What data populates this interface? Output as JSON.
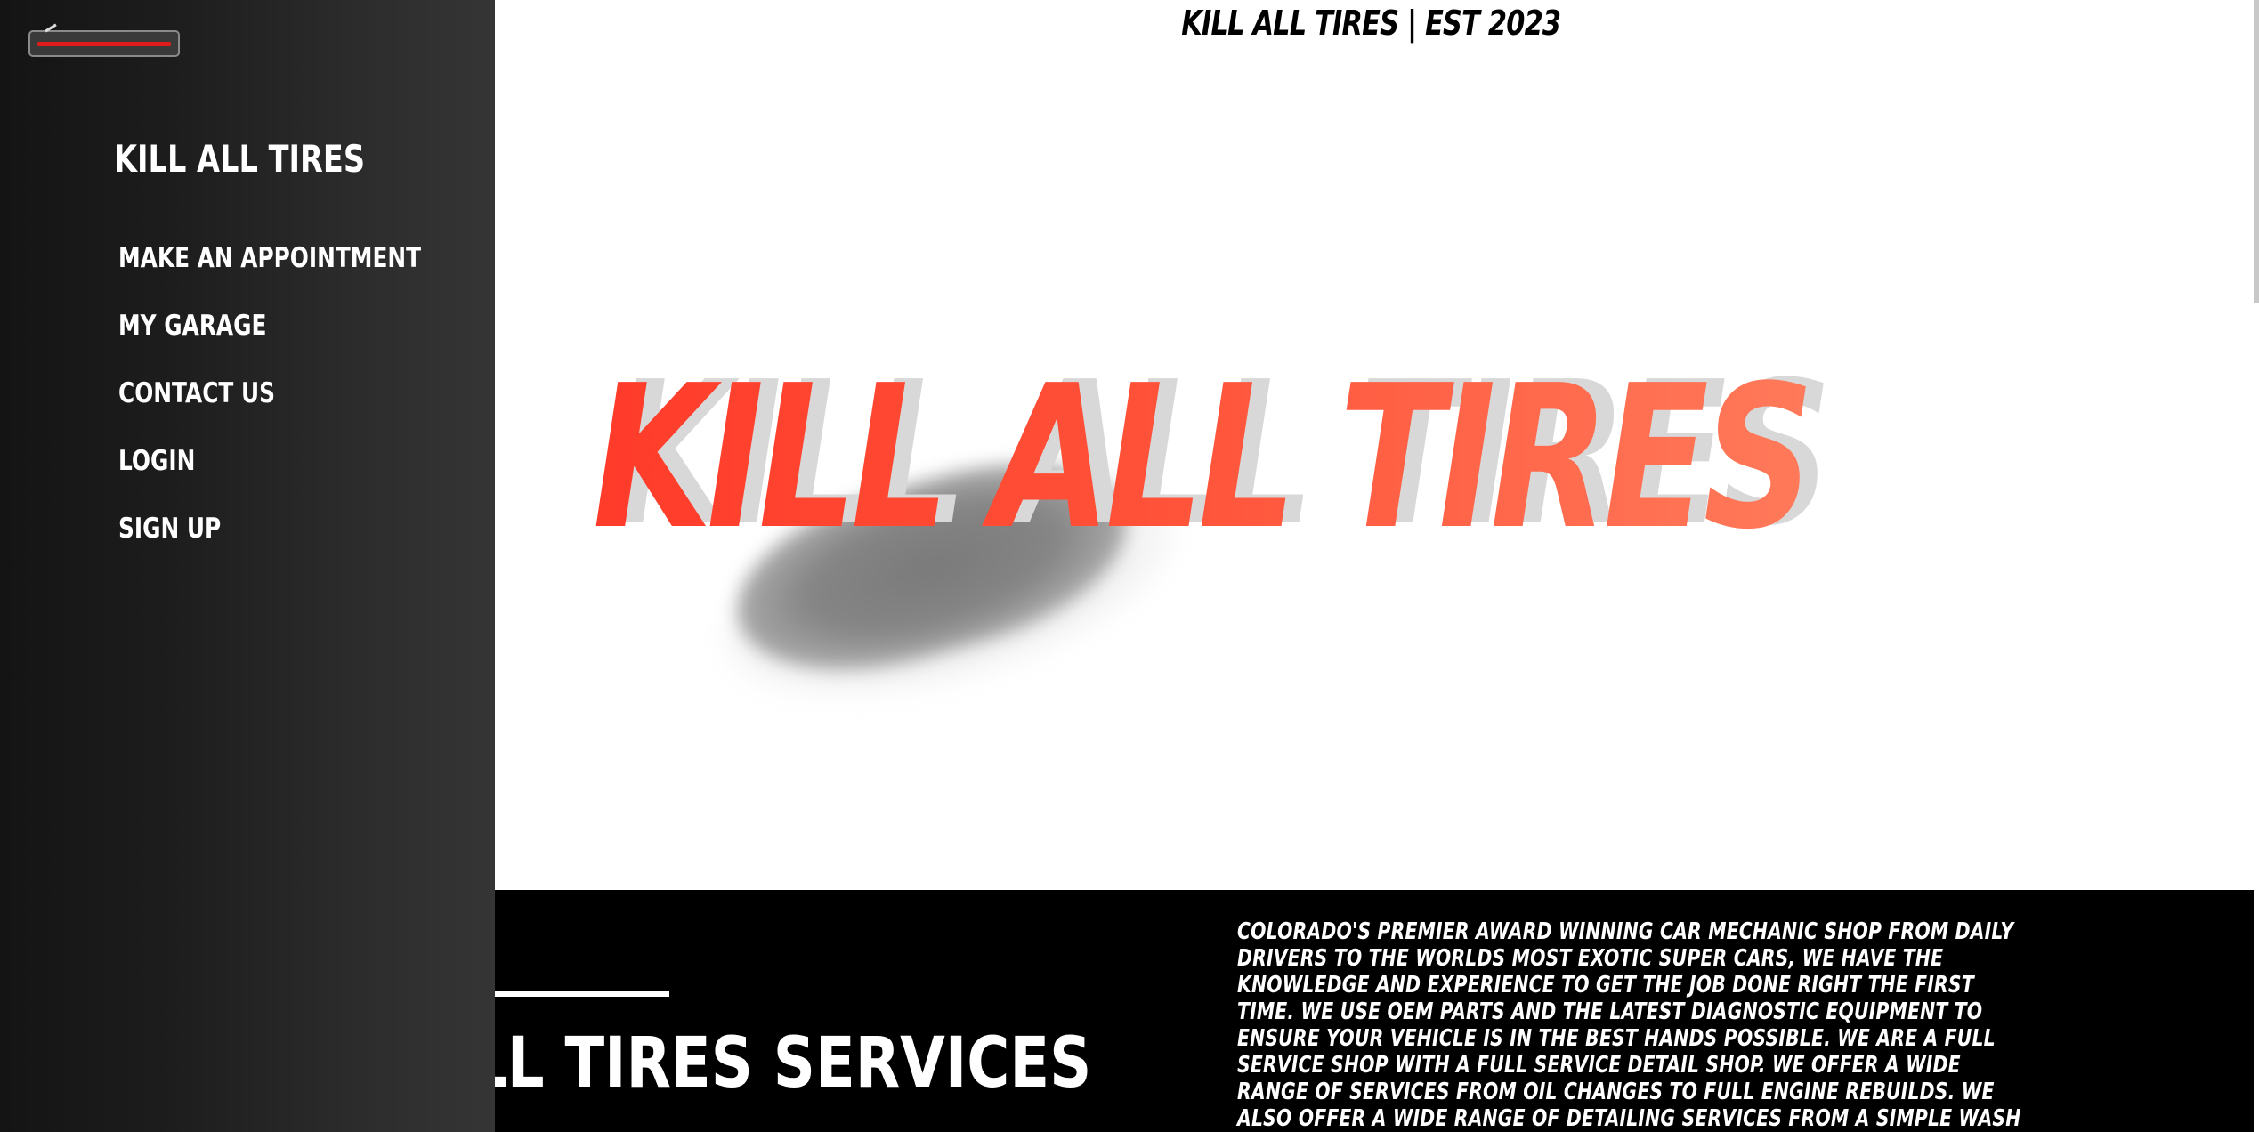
{
  "header": {
    "title": "KILL ALL TIRES | EST 2023"
  },
  "sidebar": {
    "brand": "KILL ALL TIRES",
    "toggle_icon": "hamburger-close-icon",
    "items": [
      {
        "label": "MAKE AN APPOINTMENT"
      },
      {
        "label": "MY GARAGE"
      },
      {
        "label": "CONTACT US"
      },
      {
        "label": "LOGIN"
      },
      {
        "label": "SIGN UP"
      }
    ]
  },
  "hero": {
    "title": "KILL ALL TIRES",
    "image": "car-image"
  },
  "services": {
    "title": "KILL ALL TIRES SERVICES",
    "description": "COLORADO'S PREMIER AWARD WINNING CAR MECHANIC SHOP FROM DAILY DRIVERS TO THE WORLDS MOST EXOTIC SUPER CARS, WE HAVE THE KNOWLEDGE AND EXPERIENCE TO GET THE JOB DONE RIGHT THE FIRST TIME. WE USE OEM PARTS AND THE LATEST DIAGNOSTIC EQUIPMENT TO ENSURE YOUR VEHICLE IS IN THE BEST HANDS POSSIBLE. WE ARE A FULL SERVICE SHOP WITH A FULL SERVICE DETAIL SHOP. WE OFFER A WIDE RANGE OF SERVICES FROM OIL CHANGES TO FULL ENGINE REBUILDS. WE ALSO OFFER A WIDE RANGE OF DETAILING SERVICES FROM A SIMPLE WASH AND WAX TO A FULL PAINT CORRECTION AND CERAMIC"
  },
  "colors": {
    "accent": "#ff3b2a",
    "sidebar": "#1d1d1d",
    "band": "#000000"
  }
}
